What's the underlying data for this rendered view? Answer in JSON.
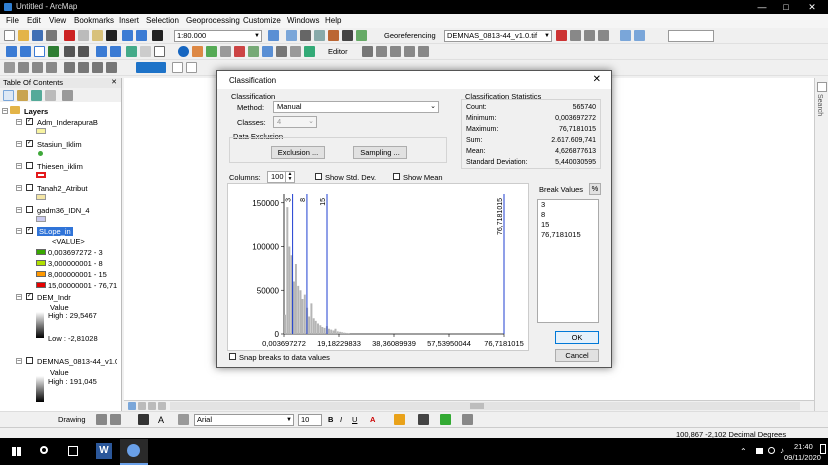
{
  "window": {
    "title": "Untitled - ArcMap"
  },
  "menu": [
    "File",
    "Edit",
    "View",
    "Bookmarks",
    "Insert",
    "Selection",
    "Geoprocessing",
    "Customize",
    "Windows",
    "Help"
  ],
  "toolbar": {
    "scale": "1:80.000",
    "georeferencing_label": "Georeferencing",
    "raster_layer": "DEMNAS_0813-44_v1.0.tif",
    "editor_label": "Editor"
  },
  "toc": {
    "header": "Table Of Contents",
    "root": "Layers",
    "layers": [
      {
        "name": "Adm_InderapuraB",
        "checked": true,
        "color": "#f7f3a1"
      },
      {
        "name": "Stasiun_Iklim",
        "checked": true,
        "color": "#3fa83a"
      },
      {
        "name": "Thiesen_iklim",
        "checked": false,
        "color": "#e31a1c"
      },
      {
        "name": "Tanah2_Atribut",
        "checked": false,
        "color": "#f4e6a6"
      },
      {
        "name": "gadm36_IDN_4",
        "checked": false,
        "color": "#c9c9ee"
      },
      {
        "name": "SLope_in",
        "checked": true,
        "selected": true
      }
    ],
    "slope_value_label": "<VALUE>",
    "slope_classes": [
      {
        "label": "0,003697272 - 3",
        "color": "#38a800"
      },
      {
        "label": "3,000000001 - 8",
        "color": "#b0e000"
      },
      {
        "label": "8,000000001 - 15",
        "color": "#ff9800"
      },
      {
        "label": "15,00000001 - 76,71",
        "color": "#e60000"
      }
    ],
    "dem_layer": {
      "name": "DEM_Indr",
      "value_label": "Value",
      "high": "High : 29,5467",
      "low": "Low : -2,81028"
    },
    "demnas_layer": {
      "name": "DEMNAS_0813-44_v1.0",
      "value_label": "Value",
      "high": "High : 191,045"
    }
  },
  "drawbar": {
    "drawing_label": "Drawing",
    "font": "Arial",
    "font_size": "10"
  },
  "status": {
    "coords": "100,867  -2,102 Decimal Degrees"
  },
  "taskbar": {
    "time": "21:40",
    "date": "09/11/2020"
  },
  "search_tab": "Search",
  "dialog": {
    "title": "Classification",
    "classification_group": "Classification",
    "method_label": "Method:",
    "method_value": "Manual",
    "classes_label": "Classes:",
    "classes_value": "4",
    "exclusion_group": "Data Exclusion",
    "exclusion_button": "Exclusion ...",
    "sampling_button": "Sampling ...",
    "stats_group": "Classification Statistics",
    "stats": [
      {
        "name": "Count:",
        "value": "565740"
      },
      {
        "name": "Minimum:",
        "value": "0,003697272"
      },
      {
        "name": "Maximum:",
        "value": "76,7181015"
      },
      {
        "name": "Sum:",
        "value": "2.617.609,741"
      },
      {
        "name": "Mean:",
        "value": "4,626877613"
      },
      {
        "name": "Standard Deviation:",
        "value": "5,440030595"
      }
    ],
    "columns_label": "Columns:",
    "columns_value": "100",
    "show_std_dev": "Show Std. Dev.",
    "show_mean": "Show Mean",
    "break_values_label": "Break Values",
    "percent_button": "%",
    "break_values": [
      "3",
      "8",
      "15",
      "76,7181015"
    ],
    "ok_button": "OK",
    "cancel_button": "Cancel",
    "snap_label": "Snap breaks to data values"
  },
  "chart_data": {
    "type": "bar",
    "title": "",
    "xlabel": "",
    "ylabel": "",
    "xlim": [
      0.003697272,
      76.7181015
    ],
    "ylim": [
      0,
      160000
    ],
    "x_ticks": [
      "0,003697272",
      "19,18229833",
      "38,36089939",
      "57,53950044",
      "76,7181015"
    ],
    "y_ticks": [
      "0",
      "50000",
      "100000",
      "150000"
    ],
    "break_lines": [
      {
        "x": 3,
        "label": "3"
      },
      {
        "x": 8,
        "label": "8"
      },
      {
        "x": 15,
        "label": "15"
      },
      {
        "x": 76.7181015,
        "label": "76,7181015"
      }
    ],
    "bins_x": [
      0.4,
      1.2,
      1.9,
      2.7,
      3.5,
      4.2,
      5.0,
      5.8,
      6.5,
      7.3,
      8.1,
      8.8,
      9.6,
      10.4,
      11.1,
      11.9,
      12.7,
      13.4,
      14.2,
      15.0,
      15.7,
      16.5,
      17.3,
      18.0,
      18.8,
      19.6,
      20.3,
      21.1,
      21.9,
      22.6
    ],
    "bins_y": [
      22000,
      145000,
      100000,
      90000,
      60000,
      80000,
      55000,
      50000,
      40000,
      45000,
      30000,
      20000,
      35000,
      18000,
      15000,
      12000,
      10000,
      8000,
      7000,
      9000,
      6000,
      5000,
      4000,
      6000,
      3000,
      2500,
      2000,
      1500,
      1200,
      1000
    ]
  }
}
